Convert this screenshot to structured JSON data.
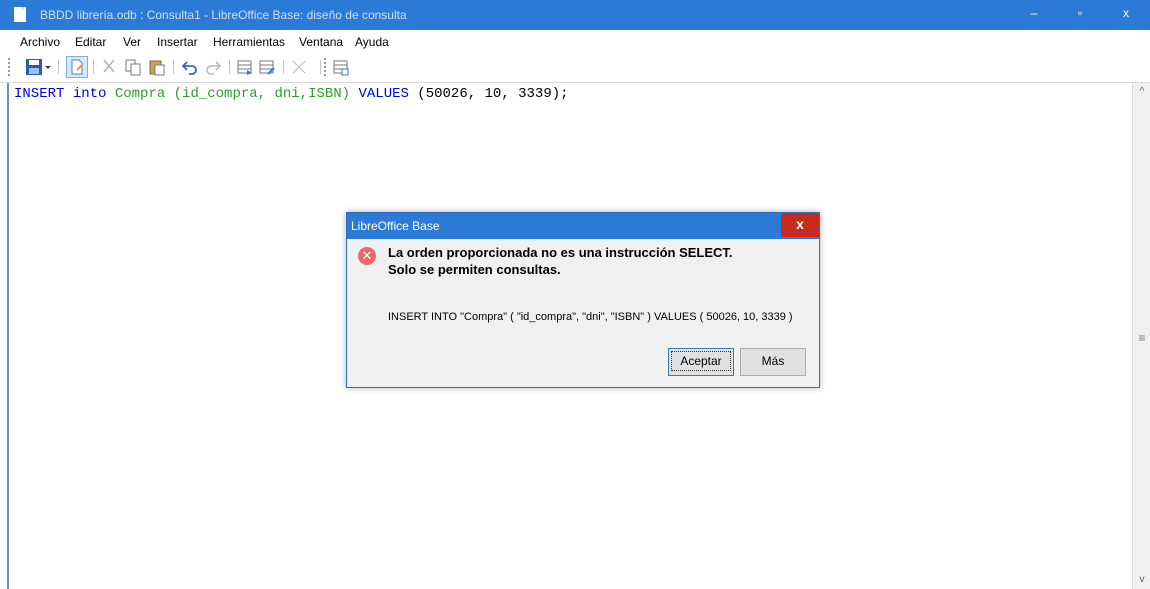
{
  "window": {
    "title": "BBDD librería.odb : Consulta1 - LibreOffice Base: diseño de consulta",
    "minimize_glyph": "‒",
    "maximize_glyph": "▫",
    "close_glyph": "x",
    "title_color": "#2b7ad6"
  },
  "menu": [
    "Archivo",
    "Editar",
    "Ver",
    "Insertar",
    "Herramientas",
    "Ventana",
    "Ayuda"
  ],
  "toolbar": {
    "icons": [
      "save-icon",
      "dropdown-arrow-icon",
      "edit-mode-icon",
      "cut-icon",
      "copy-icon",
      "paste-icon",
      "undo-icon",
      "redo-icon",
      "run-query-icon",
      "clear-query-icon",
      "delete-icon",
      "design-view-icon"
    ]
  },
  "editor": {
    "tokens": [
      {
        "text": "INSERT",
        "color": "#0000e6"
      },
      {
        "text": " ",
        "color": "#000000"
      },
      {
        "text": "into",
        "color": "#0000e6"
      },
      {
        "text": " Compra (id_compra, dni,ISBN) ",
        "color": "#2d9b2d"
      },
      {
        "text": "VALUES",
        "color": "#0000e6"
      },
      {
        "text": " (50026, 10, 3339);",
        "color": "#000000"
      }
    ]
  },
  "scrollbar": {
    "up": "^",
    "down": "v",
    "thumb": "≡"
  },
  "dialog": {
    "title": "LibreOffice Base",
    "close_label": "x",
    "error_glyph": "✕",
    "message_line1": "La orden proporcionada no es una instrucción SELECT.",
    "message_line2": "Solo se permiten consultas.",
    "detail": "INSERT INTO \"Compra\" ( \"id_compra\", \"dni\", \"ISBN\" ) VALUES ( 50026, 10, 3339 )",
    "accept_label": "Aceptar",
    "more_label": "Más"
  }
}
